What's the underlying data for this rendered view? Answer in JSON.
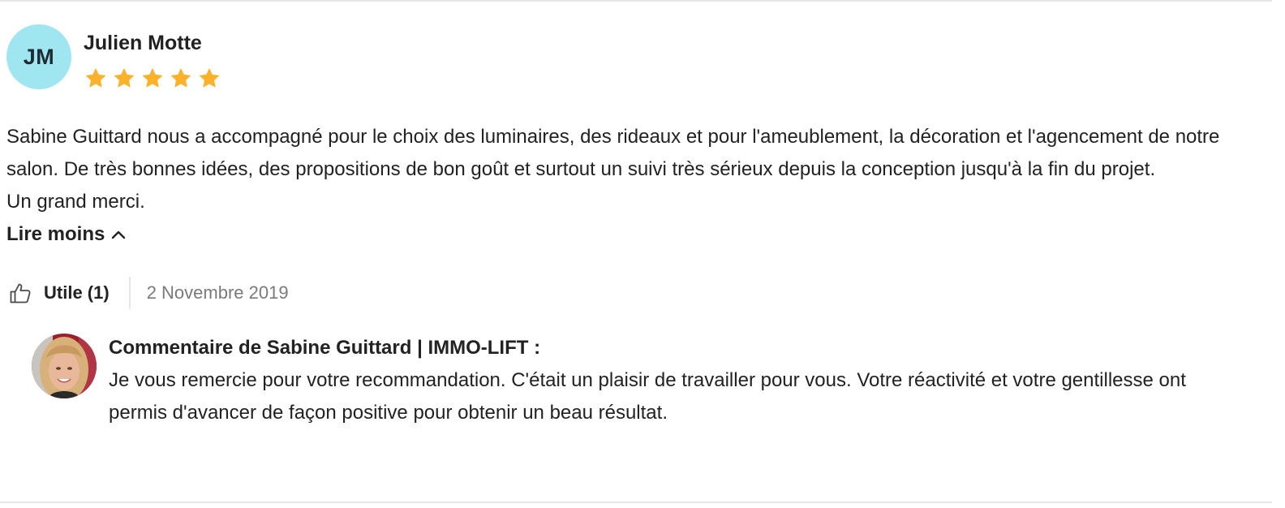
{
  "review": {
    "initials": "JM",
    "author": "Julien Motte",
    "rating": 5,
    "rating_max": 5,
    "star_color": "#fbb12a",
    "avatar_color": "#9fe6f0",
    "paragraphs": [
      "Sabine Guittard nous a accompagné pour le choix des luminaires, des rideaux et pour l'ameublement, la décoration et l'agencement de notre salon. De très bonnes idées, des propositions de bon goût et surtout un suivi très sérieux depuis la conception jusqu'à la fin du projet.",
      "Un grand merci."
    ],
    "read_less_label": "Lire moins",
    "read_less_icon": "chevron-up-icon",
    "useful_label": "Utile (1)",
    "useful_icon": "thumbs-up-icon",
    "date": "2 Novembre 2019"
  },
  "reply": {
    "title": "Commentaire de Sabine Guittard | IMMO-LIFT :",
    "text": "Je vous remercie pour votre recommandation. C'était un plaisir de travailler pour vous. Votre réactivité et votre gentillesse ont permis d'avancer de façon positive pour obtenir un beau résultat.",
    "avatar": "profile-photo"
  }
}
